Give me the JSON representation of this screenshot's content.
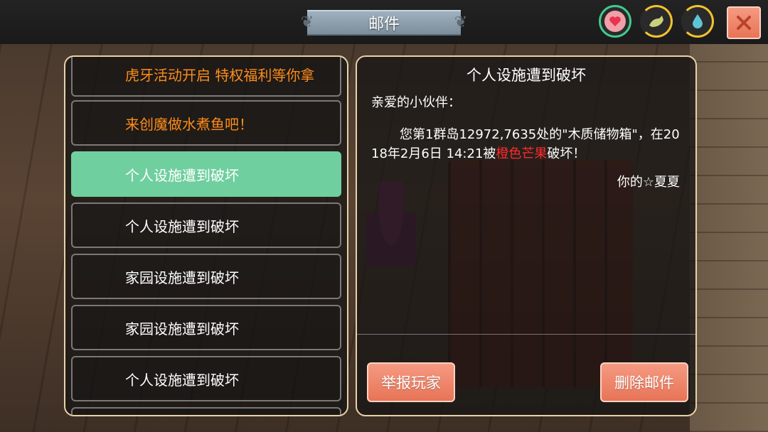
{
  "header": {
    "title": "邮件"
  },
  "status_icons": [
    {
      "name": "heart-icon",
      "color": "#41c98f"
    },
    {
      "name": "food-icon",
      "color": "#f2c230"
    },
    {
      "name": "water-drop-icon",
      "color": "#f2c230"
    }
  ],
  "close_icon": "close-icon",
  "mail_list": {
    "items": [
      {
        "label": "虎牙活动开启 特权福利等你拿",
        "state": "unread"
      },
      {
        "label": "来创魔做水煮鱼吧！",
        "state": "unread"
      },
      {
        "label": "个人设施遭到破坏",
        "state": "selected"
      },
      {
        "label": "个人设施遭到破坏",
        "state": "read"
      },
      {
        "label": "家园设施遭到破坏",
        "state": "read"
      },
      {
        "label": "家园设施遭到破坏",
        "state": "read"
      },
      {
        "label": "个人设施遭到破坏",
        "state": "read"
      }
    ]
  },
  "mail_detail": {
    "title": "个人设施遭到破坏",
    "greeting": "亲爱的小伙伴：",
    "body_prefix": "您第1群岛12972,7635处的\"木质储物箱\"，在2018年2月6日 14:21被",
    "body_highlight": "橙色芒果",
    "body_suffix": "破坏！",
    "signature": "你的☆夏夏"
  },
  "actions": {
    "report_label": "举报玩家",
    "delete_label": "删除邮件"
  },
  "colors": {
    "accent_green": "#6fcf9f",
    "button_salmon": "#e77457",
    "unread_orange": "#ff8c1a",
    "highlight_red": "#ff2a2a",
    "panel_border": "#e8d3a8"
  }
}
